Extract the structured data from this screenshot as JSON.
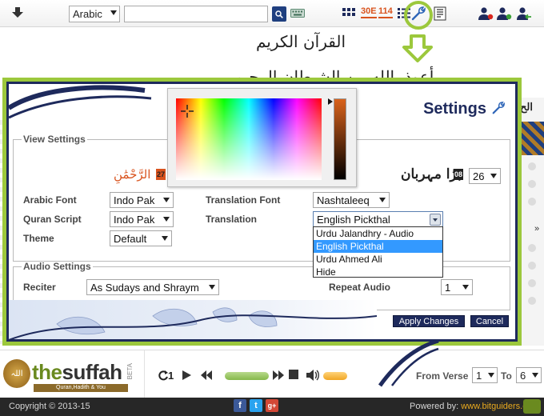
{
  "toolbar": {
    "language_selected": "Arabic",
    "search_value": "",
    "tag_icon_1": "30E",
    "tag_icon_2": "114"
  },
  "page": {
    "quran_title": "القرآن الكريم",
    "audhu": "أعوذ بالله من الشيطان الرجيم",
    "right_strip_text": "الح"
  },
  "settings": {
    "title": "Settings",
    "view_settings_legend": "View Settings",
    "arabic_sample": "الرَّحْمَٰنِ",
    "arabic_sample_ayah": "27",
    "translation_sample": "بڑا مہربان",
    "translation_sample_ayah": "08",
    "font_size_value": "26",
    "labels": {
      "arabic_font": "Arabic Font",
      "quran_script": "Quran Script",
      "theme": "Theme",
      "translation_font": "Translation Font",
      "translation": "Translation"
    },
    "values": {
      "arabic_font": "Indo Pak",
      "quran_script": "Indo Pak",
      "theme": "Default",
      "translation_font": "Nashtaleeq",
      "translation": "English Pickthal"
    },
    "translation_options": [
      "Urdu Jalandhry - Audio",
      "English Pickthal",
      "Urdu Ahmed Ali",
      "Hide"
    ],
    "translation_selected_index": 1,
    "audio_settings_legend": "Audio Settings",
    "reciter_label": "Reciter",
    "reciter_value": "As Sudays and Shraym",
    "repeat_label": "Repeat Audio",
    "repeat_value": "1",
    "apply_button": "Apply Changes",
    "cancel_button": "Cancel"
  },
  "player": {
    "logo_text_a": "the",
    "logo_text_b": "suffah",
    "logo_badge": "اللہ",
    "logo_subtitle": "Quran,Hadith & You",
    "beta": "BETA",
    "counter": "1",
    "from_verse_label": "From Verse",
    "from_verse_value": "1",
    "to_label": "To",
    "to_value": "6"
  },
  "footer": {
    "copyright": "Copyright © 2013-15",
    "powered_label": "Powered by: ",
    "powered_link": "www.bitguiders.com"
  },
  "colors": {
    "highlight_green": "#9cc83c",
    "navy": "#1e2a5c",
    "selection_blue": "#3399ff",
    "accent_orange": "#d9531e"
  }
}
